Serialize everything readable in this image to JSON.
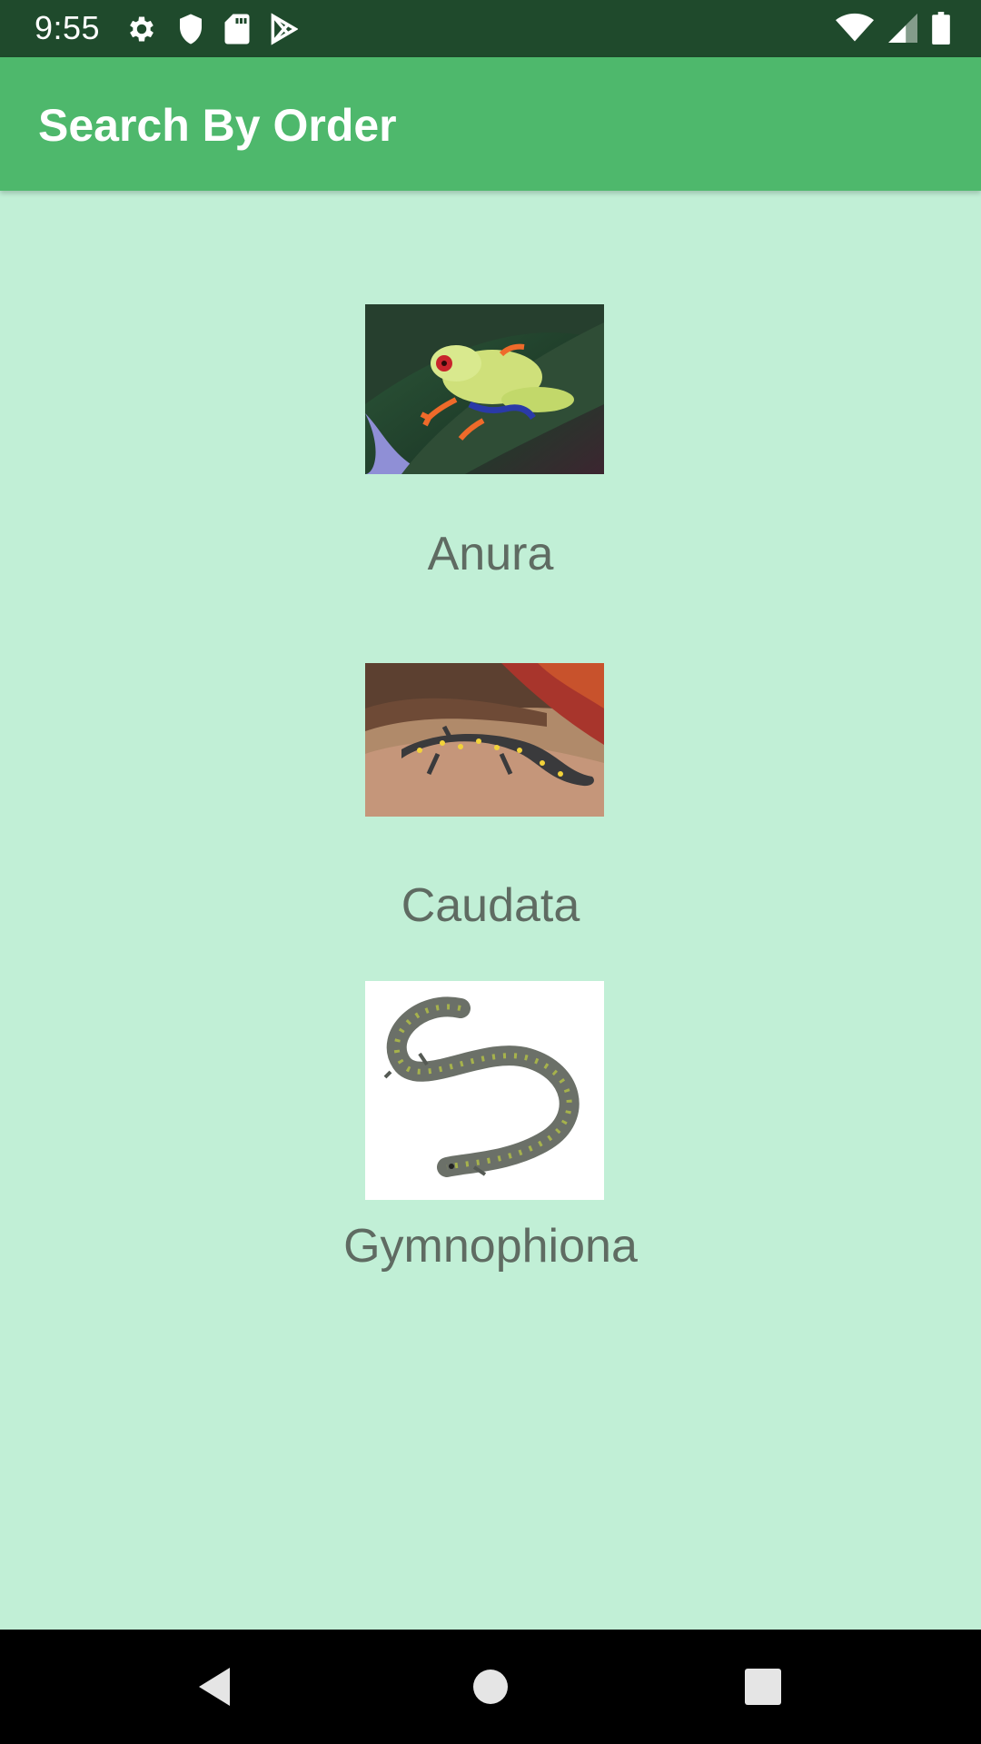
{
  "status_bar": {
    "time": "9:55",
    "left_icons": [
      "gear-icon",
      "shield-icon",
      "sd-card-icon",
      "play-store-icon"
    ],
    "right_icons": [
      "wifi-icon",
      "cell-signal-icon",
      "battery-icon"
    ]
  },
  "app_bar": {
    "title": "Search By Order"
  },
  "orders": [
    {
      "label": "Anura",
      "image": "frog-image"
    },
    {
      "label": "Caudata",
      "image": "salamander-image"
    },
    {
      "label": "Gymnophiona",
      "image": "caecilian-image"
    }
  ],
  "nav_bar": {
    "buttons": [
      "back-icon",
      "home-icon",
      "recents-icon"
    ]
  },
  "colors": {
    "status_bar": "#1f4a2c",
    "app_bar": "#4eb86c",
    "background": "#c1efd6",
    "label_text": "#5f6b62"
  }
}
